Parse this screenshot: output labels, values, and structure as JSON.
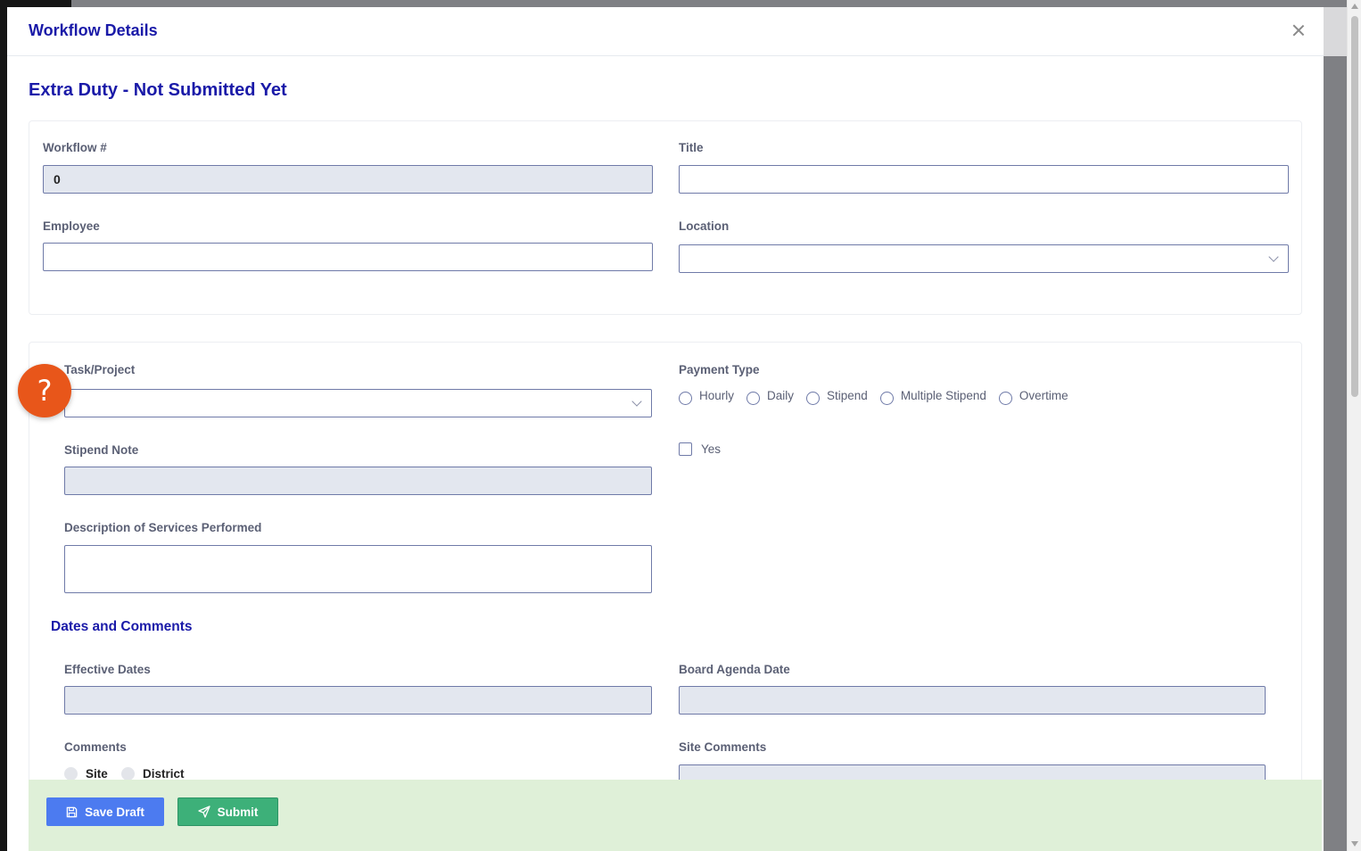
{
  "modal": {
    "title": "Workflow Details",
    "heading": "Extra Duty - Not Submitted Yet"
  },
  "general": {
    "workflow_label": "Workflow #",
    "workflow_value": "0",
    "title_label": "Title",
    "title_value": "",
    "employee_label": "Employee",
    "employee_value": "",
    "location_label": "Location",
    "location_value": ""
  },
  "task": {
    "task_label": "Task/Project",
    "task_value": "",
    "payment_type_label": "Payment Type",
    "payment_options": [
      "Hourly",
      "Daily",
      "Stipend",
      "Multiple Stipend",
      "Overtime"
    ],
    "stipend_note_label": "Stipend Note",
    "stipend_note_value": "",
    "yes_label": "Yes",
    "description_label": "Description of Services Performed",
    "description_value": ""
  },
  "dates": {
    "heading": "Dates and Comments",
    "effective_label": "Effective Dates",
    "board_label": "Board Agenda Date",
    "comments_label": "Comments",
    "comment_options": [
      "Site",
      "District"
    ],
    "site_comments_label": "Site Comments"
  },
  "footer": {
    "save_label": "Save Draft",
    "submit_label": "Submit"
  },
  "help": {
    "symbol": "?"
  },
  "colors": {
    "heading": "#1a1aa8",
    "save_button": "#4c7bf0",
    "submit_button": "#3db079",
    "help_button": "#e8561a",
    "footer_bg": "#dff0d8"
  }
}
